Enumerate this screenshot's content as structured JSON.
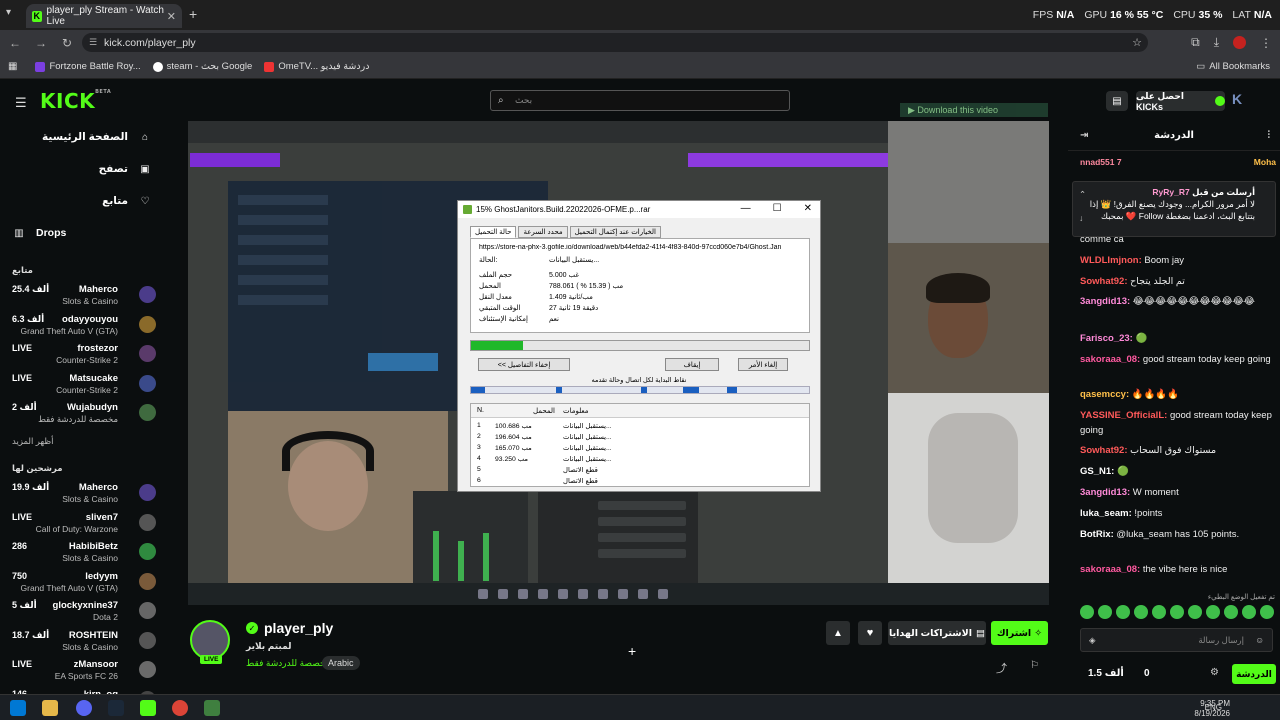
{
  "browser": {
    "tab_title": "player_ply Stream - Watch Live",
    "tab_icon": "K",
    "url": "kick.com/player_ply",
    "bookmarks": [
      "Fortzone Battle Roy...",
      "steam - بحث Google",
      "OmeTV... دردشة فيديو"
    ],
    "all_bookmarks": "All Bookmarks"
  },
  "overlay_stats": [
    {
      "k": "FPS",
      "v": "N/A"
    },
    {
      "k": "GPU",
      "v": "16 %  55 °C"
    },
    {
      "k": "CPU",
      "v": "35 %"
    },
    {
      "k": "LAT",
      "v": "N/A"
    }
  ],
  "kick": {
    "logo": "KICK",
    "logo_sup": "BETA",
    "search_placeholder": "بحث",
    "download_video": "▶ Download this video",
    "kicks_btn": "احصل على KICKs",
    "k_btn": "K"
  },
  "sidebar": {
    "nav": [
      {
        "label": "الصفحة الرئيسية",
        "icon": "⌂"
      },
      {
        "label": "تصفح",
        "icon": "▣"
      },
      {
        "label": "متابع",
        "icon": "♡"
      }
    ],
    "drops": "Drops",
    "section_following": "متابع",
    "following": [
      {
        "name": "Maherco",
        "game": "Slots & Casino",
        "viewers": "25.4 ألف"
      },
      {
        "name": "odayyouyou",
        "game": "Grand Theft Auto V (GTA)",
        "viewers": "6.3 ألف"
      },
      {
        "name": "frostezor",
        "game": "Counter-Strike 2",
        "viewers": "LIVE"
      },
      {
        "name": "Matsucake",
        "game": "Counter-Strike 2",
        "viewers": "LIVE"
      },
      {
        "name": "Wujabudyn",
        "game": "مخصصة للدردشة فقط",
        "viewers": "2 ألف"
      }
    ],
    "show_more": "أظهر المزيد",
    "section_recommended": "مرشحين لها",
    "recommended": [
      {
        "name": "Maherco",
        "game": "Slots & Casino",
        "viewers": "19.9 ألف"
      },
      {
        "name": "sliven7",
        "game": "Call of Duty: Warzone",
        "viewers": "LIVE"
      },
      {
        "name": "HabibiBetz",
        "game": "Slots & Casino",
        "viewers": "286"
      },
      {
        "name": "ledyym",
        "game": "Grand Theft Auto V (GTA)",
        "viewers": "750"
      },
      {
        "name": "glockyxnine37",
        "game": "Dota 2",
        "viewers": "5 ألف"
      },
      {
        "name": "ROSHTEIN",
        "game": "Slots & Casino",
        "viewers": "18.7 ألف"
      },
      {
        "name": "zMansoor",
        "game": "EA Sports FC 26",
        "viewers": "LIVE"
      },
      {
        "name": "kirn_og",
        "game": "",
        "viewers": "146"
      }
    ]
  },
  "download_dialog": {
    "title": "15% GhostJanitors.Build.22022026-OFME.p...rar",
    "tabs": [
      "حالة التحميل",
      "محدد السرعة",
      "الخيارات عند إكتمال التحميل"
    ],
    "url": "https://store-na-phx-3.gofile.io/download/web/b44efda2-41f4-4f83-840d-97ccd060e7b4/Ghost.Jan",
    "status_label": "الحالة:",
    "status_value": "يستقبل البيانات...",
    "rows": [
      {
        "k": "حجم الملف",
        "v": "5.000  غب"
      },
      {
        "k": "المحمل",
        "v": "788.061  مب  ( 15.39 % )"
      },
      {
        "k": "معدل النقل",
        "v": "1.409  مب/ثانية"
      },
      {
        "k": "الوقت المتبقي",
        "v": "27 دقيقة 19 ثانية"
      },
      {
        "k": "إمكانية الإستئناف",
        "v": "نعم"
      }
    ],
    "progress": 0.1539,
    "btn_hide": "<< إخفاء التفاصيل",
    "btn_pause": "إيقاف",
    "btn_cancel": "إلغاء الأمر",
    "conn_title": "نقاط البداية لكل اتصال وحالة تقدمه",
    "table_headers": [
      "N.",
      "المحمل",
      "معلومات"
    ],
    "table_rows": [
      {
        "n": "1",
        "size": "100.686  مب",
        "info": "يستقبل البيانات..."
      },
      {
        "n": "2",
        "size": "196.604  مب",
        "info": "يستقبل البيانات..."
      },
      {
        "n": "3",
        "size": "165.070  مب",
        "info": "يستقبل البيانات..."
      },
      {
        "n": "4",
        "size": "93.250  مب",
        "info": "يستقبل البيانات..."
      },
      {
        "n": "5",
        "size": "",
        "info": "قطع الاتصال"
      },
      {
        "n": "6",
        "size": "",
        "info": "قطع الاتصال"
      }
    ]
  },
  "streamer": {
    "name": "player_ply",
    "title": "لمبتم بلاير",
    "category": "مخصصة للدردشة فقط",
    "language": "Arabic",
    "live": "LIVE",
    "subscribe": "اشتراك",
    "gift_subs": "الاشتراكات الهدايا",
    "heart": "♥",
    "bell": "🔔"
  },
  "chat": {
    "header": "الدردشة",
    "pin_top_left": "nnad551 7",
    "pin_top_right": "Moha",
    "pinned_author": "RyRy_R7",
    "pinned_sent": "أرسلت من قبل",
    "pinned_text": "لا أمر مرور الكرام... وجودك يصنع الفرق! 👑 إذا بتتابع البث، ادعمنا بضغطة Follow ❤️ بمحبك",
    "messages": [
      {
        "user": "",
        "text": "comme ca",
        "color": "#eeeeee"
      },
      {
        "user": "WLDLImjnon:",
        "text": "Boom jay",
        "color": "#ff5a5a"
      },
      {
        "user": "Sowhat92:",
        "text": "تم الجلد يتجاح",
        "color": "#ff5a5a"
      },
      {
        "user": "3angdid13:",
        "text": "😂😂😂😂😂😂😂😂😂😂😂",
        "color": "#ff8ad8"
      },
      {
        "user": "Farisco_23:",
        "text": "🟢",
        "color": "#ff8ad8"
      },
      {
        "user": "sakoraaa_08:",
        "text": "good stream today keep going",
        "color": "#ff5aa0"
      },
      {
        "user": "qasemccy:",
        "text": "🔥🔥🔥🔥",
        "color": "#ffc04a"
      },
      {
        "user": "YASSINE_OfficialL:",
        "text": "good stream today keep going",
        "color": "#ff5a5a"
      },
      {
        "user": "Sowhat92:",
        "text": "مستواك فوق السحاب",
        "color": "#ff5a5a"
      },
      {
        "user": "GS_N1:",
        "text": "🟢",
        "color": "#ffffff"
      },
      {
        "user": "3angdid13:",
        "text": "W moment",
        "color": "#ff8ad8"
      },
      {
        "user": "luka_seam:",
        "text": "!points",
        "color": "#ffffff"
      },
      {
        "user": "BotRix:",
        "text": "@luka_seam has 105 points.",
        "color": "#ffffff"
      },
      {
        "user": "sakoraaa_08:",
        "text": "the vibe here is nice",
        "color": "#ff5aa0"
      }
    ],
    "emote_label": "تم تفعيل الوضع البطيء",
    "input_placeholder": "إرسال رسالة",
    "points": "1.5 ألف",
    "kicks": "0",
    "send": "الدردشة"
  },
  "taskbar": {
    "lang": "ENG",
    "time": "9:35 PM",
    "date": "8/19/2026"
  },
  "colors": {
    "kick_green": "#53fc18",
    "bg": "#0b0e0f"
  }
}
